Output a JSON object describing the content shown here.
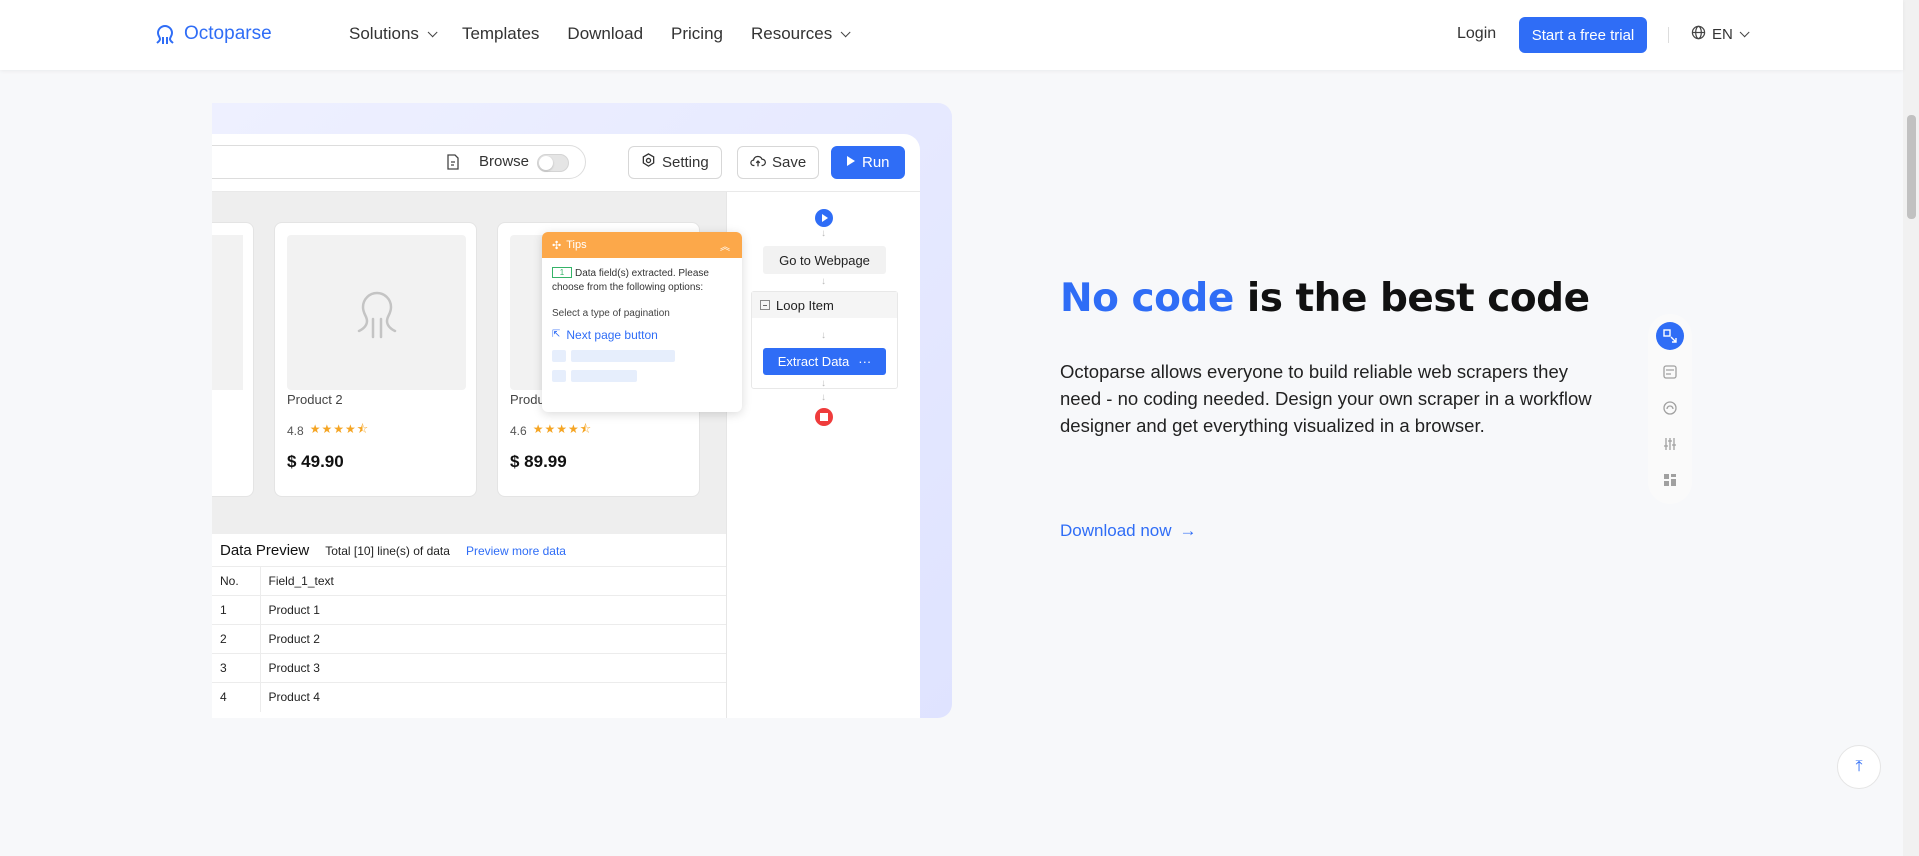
{
  "nav": {
    "logo_text": "Octoparse",
    "links": [
      {
        "label": "Solutions",
        "has_dropdown": true
      },
      {
        "label": "Templates",
        "has_dropdown": false
      },
      {
        "label": "Download",
        "has_dropdown": false
      },
      {
        "label": "Pricing",
        "has_dropdown": false
      },
      {
        "label": "Resources",
        "has_dropdown": true
      }
    ],
    "login": "Login",
    "trial_button": "Start a free trial",
    "language": "EN",
    "accent_color": "#2f6df6"
  },
  "demo": {
    "toolbar": {
      "browse_label": "Browse",
      "setting_label": "Setting",
      "save_label": "Save",
      "run_label": "Run"
    },
    "products": [
      {
        "name": "Product 2",
        "rating": "4.8",
        "price": "$ 49.90"
      },
      {
        "name": "Product 3",
        "rating": "4.6",
        "price": "$ 89.99"
      }
    ],
    "tips": {
      "title": "Tips",
      "badge": "1",
      "message": "Data field(s) extracted. Please choose from the following options:",
      "subtitle": "Select a type of pagination",
      "option": "Next page button"
    },
    "preview": {
      "title": "Data Preview",
      "total": "Total [10] line(s) of data",
      "more_link": "Preview more data",
      "headers": [
        "No.",
        "Field_1_text"
      ],
      "rows": [
        [
          "1",
          "Product 1"
        ],
        [
          "2",
          "Product 2"
        ],
        [
          "3",
          "Product 3"
        ],
        [
          "4",
          "Product 4"
        ]
      ]
    },
    "workflow": {
      "goto": "Go to Webpage",
      "loop": "Loop Item",
      "extract": "Extract Data",
      "extract_more": "···"
    }
  },
  "hero": {
    "heading_accent": "No code",
    "heading_rest": " is the best code",
    "description": "Octoparse allows everyone to build reliable web scrapers they need - no coding needed. Design your own scraper in a workflow designer and get everything visualized in a browser.",
    "cta": "Download now",
    "cta_arrow": "→"
  },
  "side_widget": {
    "icons": [
      "scrape-icon",
      "template-icon",
      "cloud-icon",
      "settings-sliders-icon",
      "dashboard-icon"
    ]
  },
  "back_to_top": "⤒"
}
